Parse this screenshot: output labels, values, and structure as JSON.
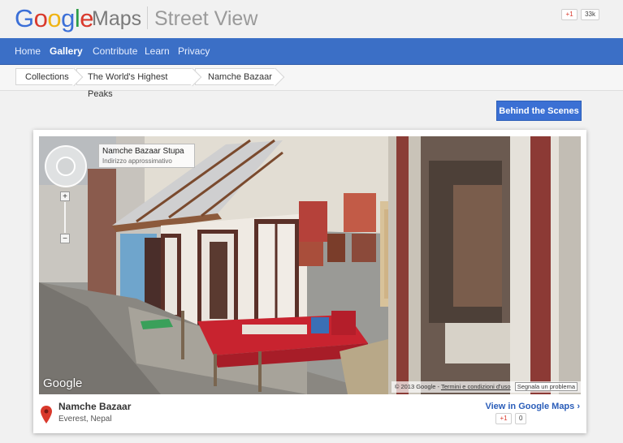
{
  "header": {
    "logo_letters": [
      "G",
      "o",
      "o",
      "g",
      "l",
      "e"
    ],
    "maps_label": "Maps",
    "streetview_label": "Street View",
    "plusone_label": "+1",
    "plusone_count": "33k"
  },
  "nav": {
    "items": [
      {
        "label": "Home",
        "active": false
      },
      {
        "label": "Gallery",
        "active": true
      },
      {
        "label": "Contribute",
        "active": false
      },
      {
        "label": "Learn",
        "active": false
      },
      {
        "label": "Privacy",
        "active": false
      }
    ]
  },
  "breadcrumb": {
    "items": [
      "Collections",
      "The World's Highest Peaks",
      "Namche Bazaar"
    ]
  },
  "behind_scenes_label": "Behind the Scenes",
  "viewer": {
    "place_label_name": "Namche Bazaar Stupa",
    "place_label_sub": "Indirizzo approssimativo",
    "zoom_in": "+",
    "zoom_out": "−",
    "watermark": "Google",
    "copyright": "© 2013 Google",
    "terms_link": "Termini e condizioni d'uso",
    "report_label": "Segnala un problema"
  },
  "place": {
    "name": "Namche Bazaar",
    "location": "Everest, Nepal",
    "view_link": "View in Google Maps ›",
    "plusone_label": "+1",
    "plusone_count": "0"
  },
  "colors": {
    "nav_bg": "#3b6fc6",
    "button_bg": "#3b70d4",
    "link": "#2a5db9",
    "pin": "#d9392c"
  }
}
